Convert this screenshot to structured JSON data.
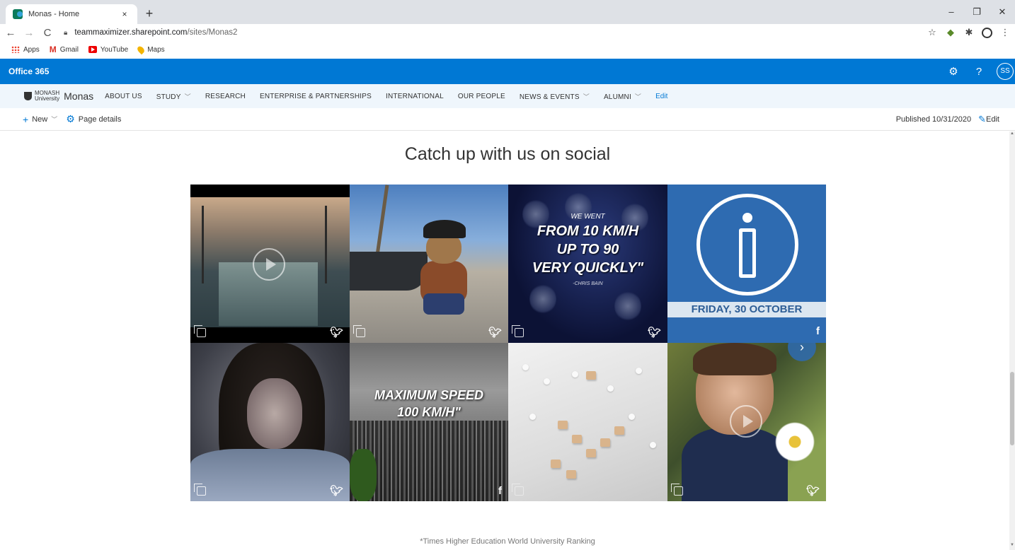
{
  "browser": {
    "tab_title": "Monas - Home",
    "tab_close": "×",
    "new_tab": "+",
    "window": {
      "minimize": "–",
      "restore": "❐",
      "close": "✕"
    },
    "url_host": "teammaximizer.sharepoint.com",
    "url_path": "/sites/Monas2",
    "bookmarks": [
      {
        "label": "Apps",
        "icon": "apps-grid-icon"
      },
      {
        "label": "Gmail",
        "icon": "gmail-icon"
      },
      {
        "label": "YouTube",
        "icon": "youtube-icon"
      },
      {
        "label": "Maps",
        "icon": "maps-pin-icon"
      }
    ]
  },
  "suite": {
    "title": "Office 365",
    "avatar_initials": "SS",
    "help": "?"
  },
  "site": {
    "logo_line1": "MONASH",
    "logo_line2": "University",
    "title": "Monas",
    "nav": [
      {
        "label": "ABOUT US",
        "has_dropdown": false
      },
      {
        "label": "STUDY",
        "has_dropdown": true
      },
      {
        "label": "RESEARCH",
        "has_dropdown": false
      },
      {
        "label": "ENTERPRISE & PARTNERSHIPS",
        "has_dropdown": false
      },
      {
        "label": "INTERNATIONAL",
        "has_dropdown": false
      },
      {
        "label": "OUR PEOPLE",
        "has_dropdown": false
      },
      {
        "label": "NEWS & EVENTS",
        "has_dropdown": true
      },
      {
        "label": "ALUMNI",
        "has_dropdown": true
      }
    ],
    "nav_edit": "Edit"
  },
  "commandbar": {
    "new_label": "New",
    "page_details_label": "Page details",
    "published": "Published 10/31/2020",
    "edit_label": "Edit"
  },
  "content": {
    "section_title": "Catch up with us on social",
    "tiles": [
      {
        "network": "twitter",
        "multi": true,
        "video": true
      },
      {
        "network": "twitter",
        "multi": true,
        "video": false
      },
      {
        "network": "twitter",
        "multi": true,
        "video": false,
        "quote_intro": "WE WENT",
        "quote_lines": [
          "FROM 10 KM/H",
          "UP TO 90",
          "VERY QUICKLY\""
        ],
        "quote_source": "-CHRIS BAIN"
      },
      {
        "network": "facebook",
        "multi": false,
        "video": false,
        "date_text": "FRIDAY, 30 OCTOBER",
        "has_next": true
      },
      {
        "network": "twitter",
        "multi": true,
        "video": false
      },
      {
        "network": "facebook",
        "multi": false,
        "video": false,
        "quote_lines": [
          "MAXIMUM SPEED",
          "100 KM/H\""
        ]
      },
      {
        "network": "none",
        "multi": true,
        "video": false
      },
      {
        "network": "twitter",
        "multi": true,
        "video": true
      }
    ],
    "footnote": "*Times Higher Education World University Ranking"
  }
}
